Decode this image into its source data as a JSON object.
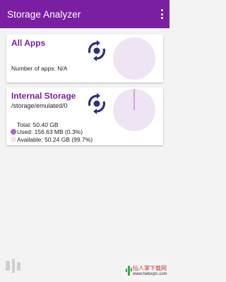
{
  "appbar": {
    "title": "Storage Analyzer"
  },
  "apps_card": {
    "title": "All Apps",
    "count_text": "Number of apps: N/A"
  },
  "storage_card": {
    "title": "Internal Storage",
    "path": "/storage/emulated/0",
    "total": "Total: 50.40 GB",
    "used": "Used: 156.63 MB (0.3%)",
    "available": "Available: 50.24 GB (99.7%)",
    "used_fraction": 0.003,
    "colors": {
      "used": "#b163c9",
      "available": "#eee4f3"
    }
  },
  "colors": {
    "primary": "#7a1fa2",
    "icon": "#2e2f82"
  },
  "icons": {
    "menu": "overflow-menu-icon",
    "refresh": "refresh-icon"
  },
  "watermark": {
    "brand": "仙人掌下载网",
    "url": "www.hebxqrc.com"
  }
}
